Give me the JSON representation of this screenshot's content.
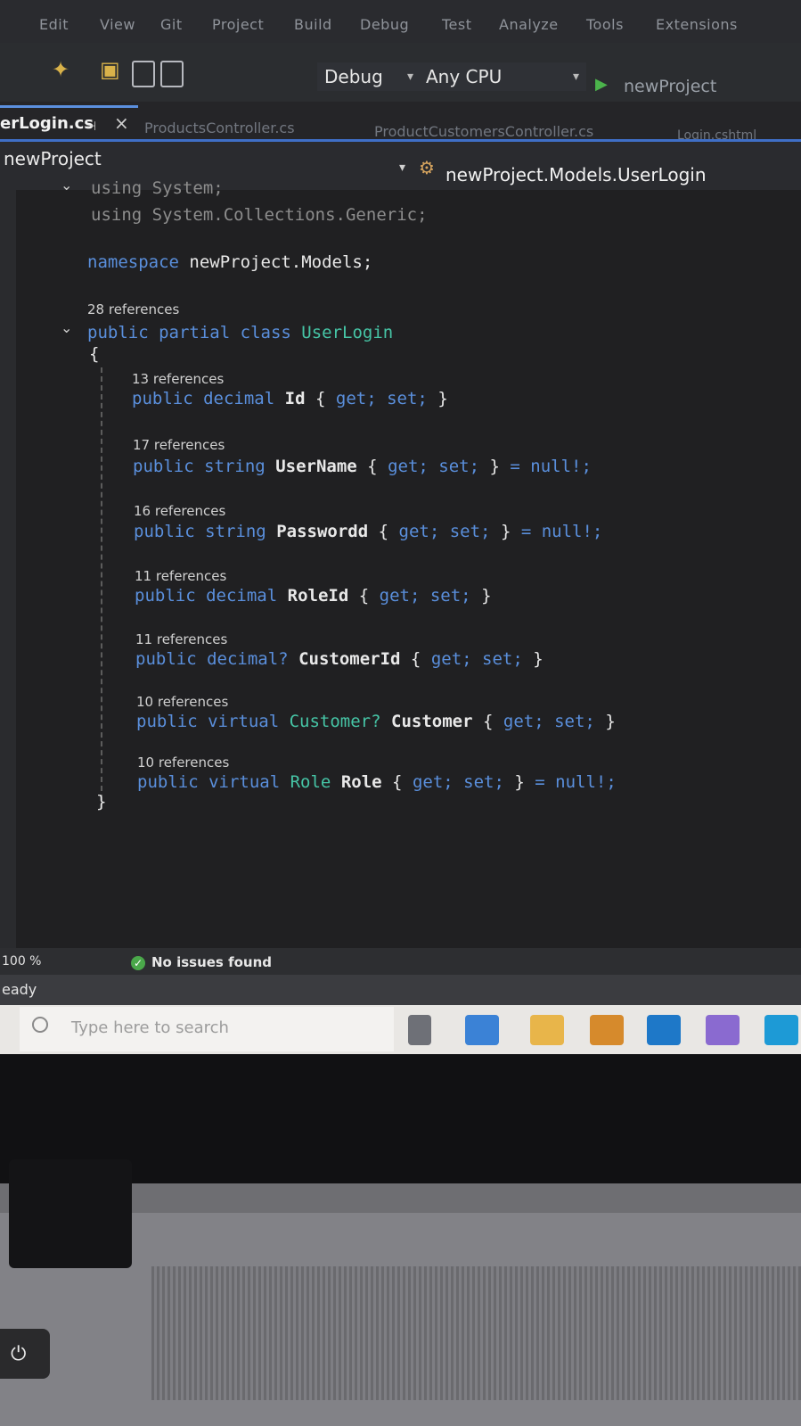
{
  "menu": [
    "Edit",
    "View",
    "Git",
    "Project",
    "Build",
    "Debug",
    "Test",
    "Analyze",
    "Tools",
    "Extensions"
  ],
  "toolbar": {
    "config": "Debug",
    "platform": "Any CPU",
    "run_target": "newProject"
  },
  "tabs": [
    {
      "label": "erLogin.cs",
      "active": true
    },
    {
      "label": "ProductsController.cs",
      "active": false
    },
    {
      "label": "ProductCustomersController.cs",
      "active": false
    },
    {
      "label": "Login.cshtml",
      "active": false
    }
  ],
  "nav": {
    "project": "newProject",
    "member": "newProject.Models.UserLogin"
  },
  "code": {
    "using1_kw": "using",
    "using1": "System;",
    "using2_kw": "using",
    "using2": "System.Collections.Generic;",
    "namespace_kw": "namespace",
    "namespace_name": "newProject.Models;",
    "class_refs": "28 references",
    "class_kw1": "public",
    "class_kw2": "partial",
    "class_kw3": "class",
    "class_name": "UserLogin",
    "open_brace": "{",
    "close_brace": "}",
    "props": [
      {
        "refs": "13 references",
        "mod": "public",
        "type": "decimal",
        "name": "Id",
        "acc_open": "{",
        "get": "get;",
        "set": "set;",
        "acc_close": "}",
        "init": ""
      },
      {
        "refs": "17 references",
        "mod": "public",
        "type": "string",
        "name": "UserName",
        "acc_open": "{",
        "get": "get;",
        "set": "set;",
        "acc_close": "}",
        "init": "= null!;"
      },
      {
        "refs": "16 references",
        "mod": "public",
        "type": "string",
        "name": "Passwordd",
        "acc_open": "{",
        "get": "get;",
        "set": "set;",
        "acc_close": "}",
        "init": "= null!;"
      },
      {
        "refs": "11 references",
        "mod": "public",
        "type": "decimal",
        "name": "RoleId",
        "acc_open": "{",
        "get": "get;",
        "set": "set;",
        "acc_close": "}",
        "init": ""
      },
      {
        "refs": "11 references",
        "mod": "public",
        "type": "decimal?",
        "name": "CustomerId",
        "acc_open": "{",
        "get": "get;",
        "set": "set;",
        "acc_close": "}",
        "init": ""
      },
      {
        "refs": "10 references",
        "mod": "public virtual",
        "type": "Customer?",
        "name": "Customer",
        "acc_open": "{",
        "get": "get;",
        "set": "set;",
        "acc_close": "}",
        "init": ""
      },
      {
        "refs": "10 references",
        "mod": "public virtual",
        "type": "Role",
        "name": "Role",
        "acc_open": "{",
        "get": "get;",
        "set": "set;",
        "acc_close": "}",
        "init": "= null!;"
      }
    ]
  },
  "status": {
    "zoom": "100 %",
    "issues": "No issues found",
    "state": "eady"
  },
  "taskbar": {
    "search_placeholder": "Type here to search"
  },
  "colors": {
    "keyword": "#5a8fdc",
    "type": "#46c5a6",
    "accent": "#3f6fc7"
  }
}
